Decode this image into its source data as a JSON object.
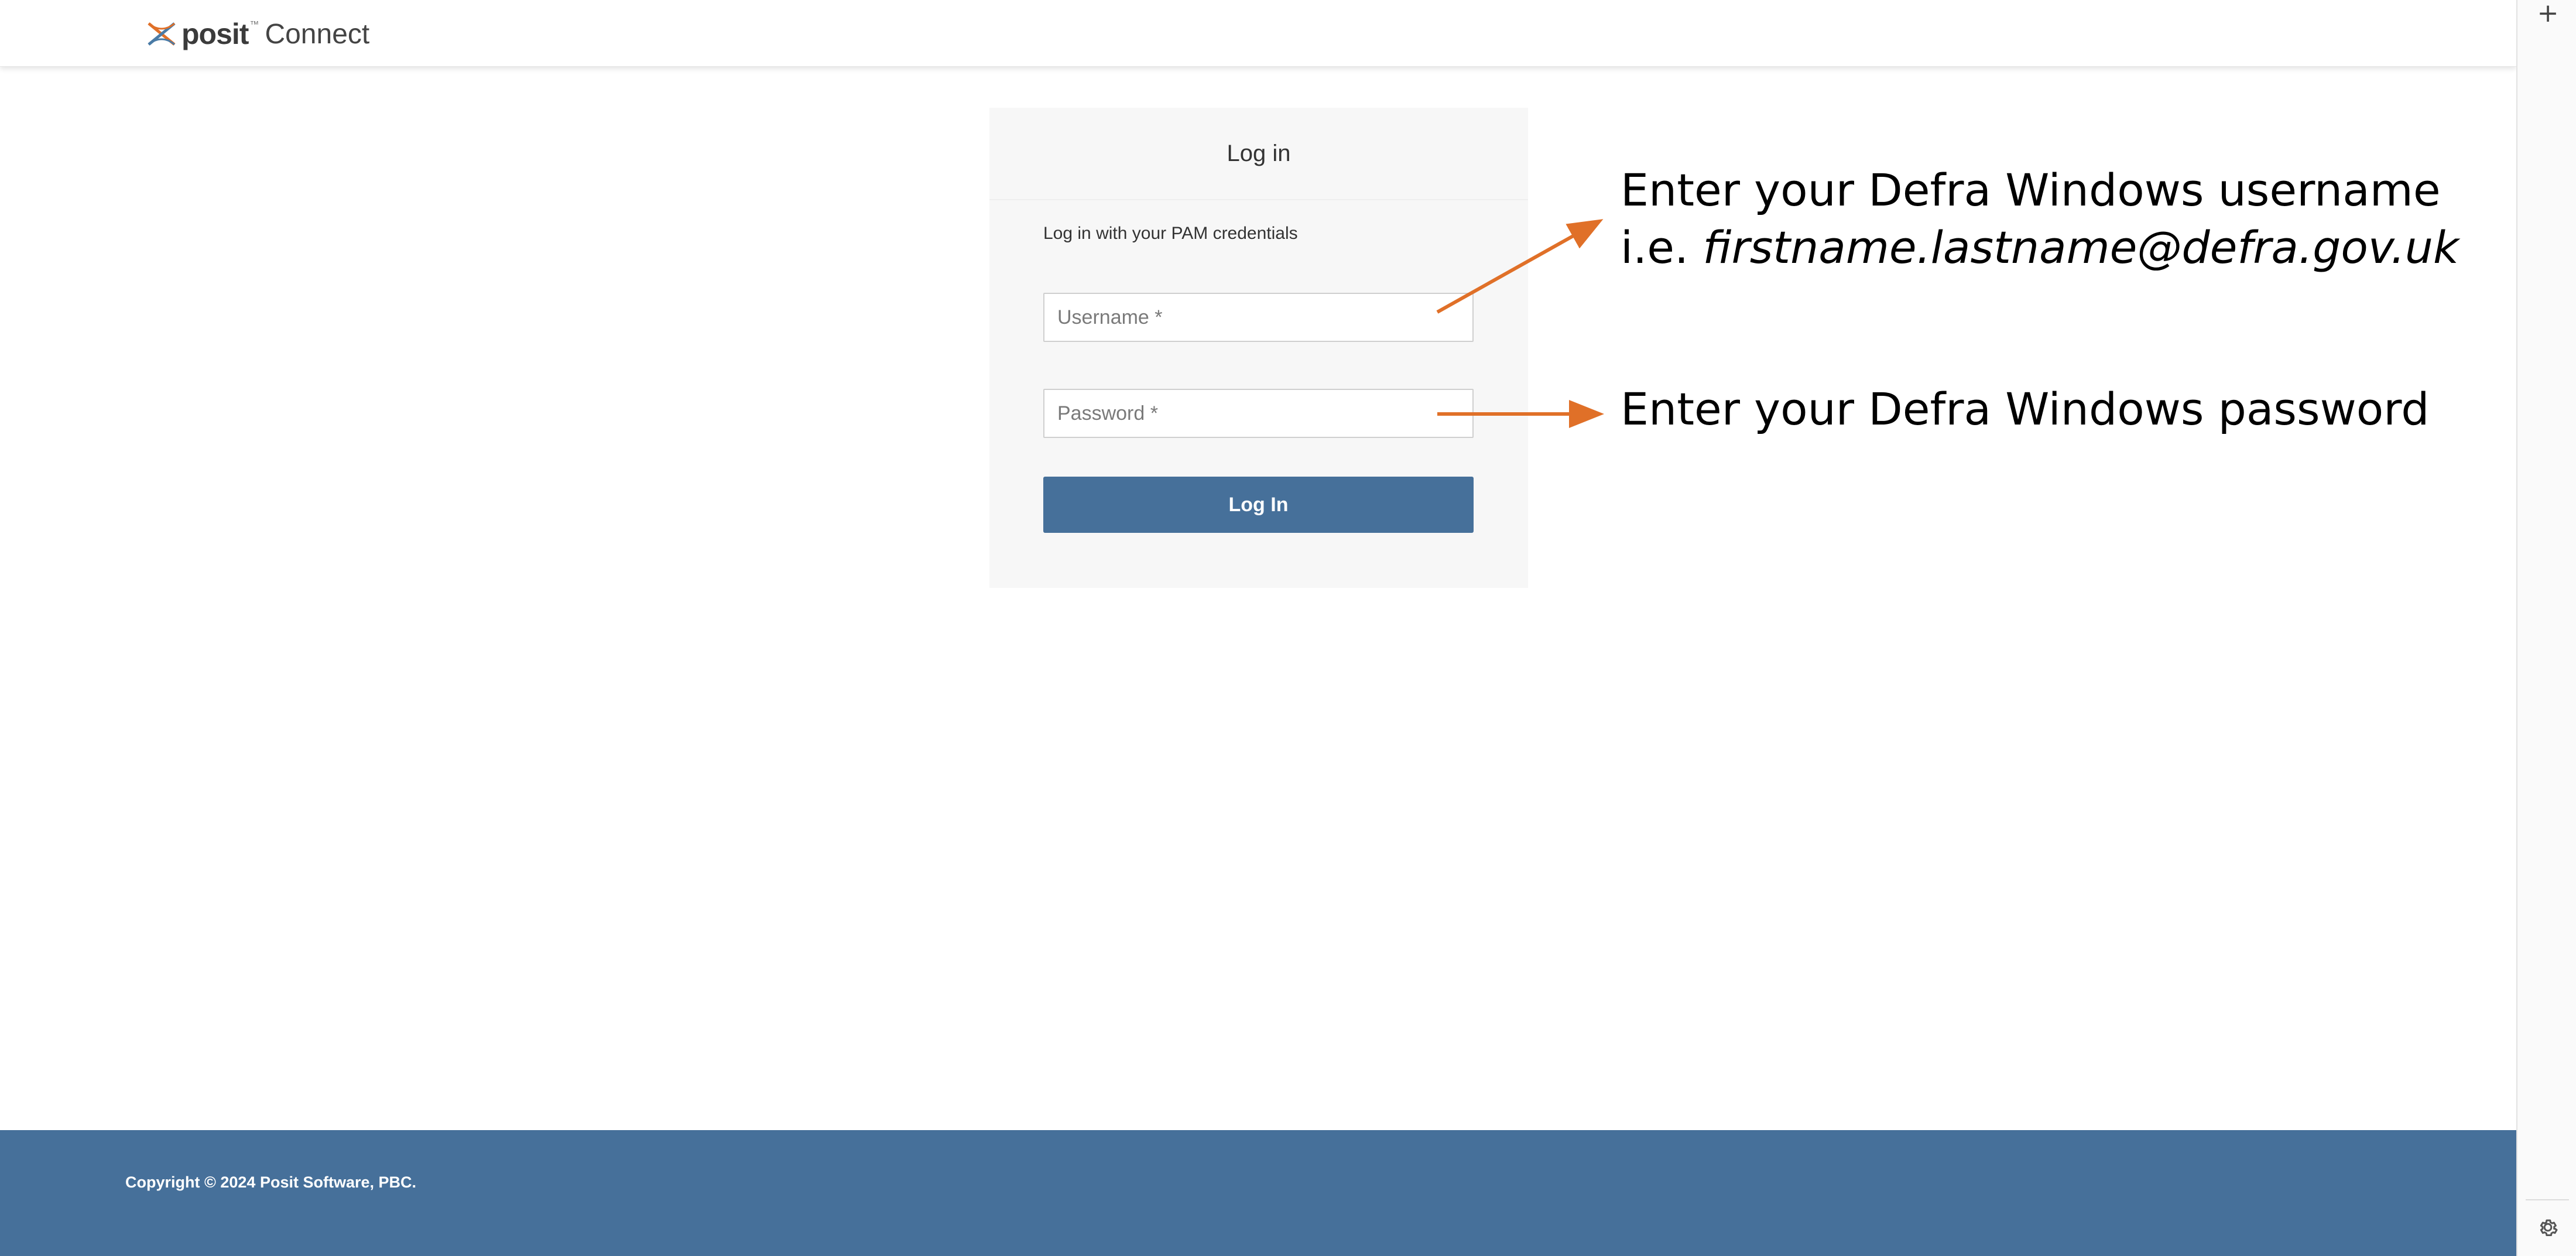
{
  "header": {
    "logo_word": "posit",
    "logo_tm": "™",
    "product_name": "Connect"
  },
  "login": {
    "title": "Log in",
    "subtitle": "Log in with your PAM credentials",
    "username_placeholder": "Username *",
    "password_placeholder": "Password *",
    "submit_label": "Log In"
  },
  "annotations": {
    "username_line1": "Enter your Defra Windows username",
    "username_prefix": "i.e. ",
    "username_example": "firstname.lastname@defra.gov.uk",
    "password_line": "Enter your Defra Windows password",
    "arrow_color": "#e07028"
  },
  "footer": {
    "copyright": "Copyright © 2024 Posit Software, PBC."
  },
  "colors": {
    "brand_blue": "#46709a",
    "panel_bg": "#f7f7f7",
    "logo_orange": "#e07028",
    "logo_blue": "#4a7ba6"
  },
  "icons": {
    "logo": "posit-logo-icon",
    "add": "plus-icon",
    "settings": "gear-icon"
  }
}
